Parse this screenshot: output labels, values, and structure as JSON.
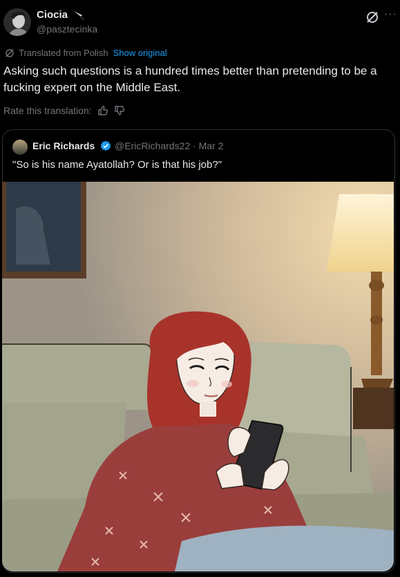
{
  "author": {
    "name": "Ciocia",
    "handle": "@pasztecinka"
  },
  "translation": {
    "note": "Translated from Polish",
    "show_original": "Show original",
    "rate_label": "Rate this translation:"
  },
  "tweet_text": "Asking such questions is a hundred times better than pretending to be a fucking expert on the Middle East.",
  "quote": {
    "name": "Eric Richards",
    "handle_date": "@EricRichards22 · Mar 2",
    "text": "\"So is his name Ayatollah? Or is that his job?\""
  },
  "icons": {
    "knife": "knife-emoji-icon",
    "grok": "grok-icon",
    "more": "more-options-icon",
    "translate": "translate-icon",
    "thumbs_up": "thumbs-up-icon",
    "thumbs_down": "thumbs-down-icon",
    "verified": "verified-badge-icon"
  },
  "colors": {
    "background": "#000000",
    "text": "#e7e9ea",
    "muted": "#71767b",
    "link": "#1d9bf0",
    "border": "#2f3336"
  }
}
